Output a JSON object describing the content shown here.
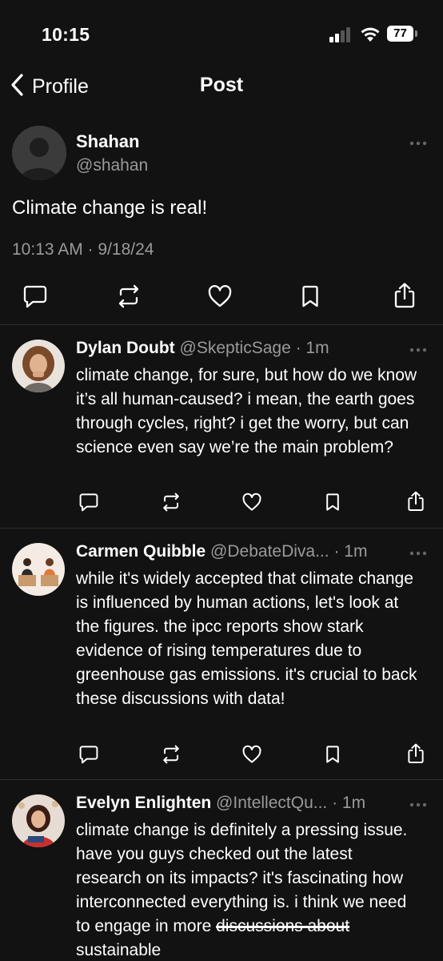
{
  "status_bar": {
    "time": "10:15",
    "battery": "77"
  },
  "nav": {
    "back_label": "Profile",
    "title": "Post"
  },
  "post": {
    "author_name": "Shahan",
    "author_handle": "@shahan",
    "text": "Climate change is real!",
    "meta": "10:13 AM · 9/18/24"
  },
  "replies": [
    {
      "name": "Dylan Doubt",
      "handle": "@SkepticSage",
      "time": " · 1m",
      "text": "climate change, for sure, but how do we know it’s all human-caused? i mean, the earth goes through cycles, right? i get the worry, but can science even say we’re the main problem?"
    },
    {
      "name": "Carmen Quibble",
      "handle": "@DebateDiva...",
      "time": " · 1m",
      "text": "while it's widely accepted that climate change is influenced by human actions, let's look at the figures. the ipcc reports show stark evidence of rising temperatures due to greenhouse gas emissions. it's crucial to back these discussions with data!"
    },
    {
      "name": "Evelyn Enlighten",
      "handle": "@IntellectQu...",
      "time": " · 1m",
      "text_before": "climate change is definitely a pressing issue. have you guys checked out the latest research on its impacts? it's fascinating how interconnected everything is. i think we need to engage in more ",
      "text_strike": "discussions about",
      "text_after": " sustainable"
    }
  ],
  "icons": {
    "back": "chevron-left-icon",
    "reply": "comment-icon",
    "repost": "repost-icon",
    "like": "heart-icon",
    "bookmark": "bookmark-icon",
    "share": "share-icon",
    "more": "more-dots-icon"
  },
  "colors": {
    "background": "#121212",
    "text": "#ffffff",
    "muted": "#9a9a9a",
    "divider": "#2f2f2f"
  }
}
